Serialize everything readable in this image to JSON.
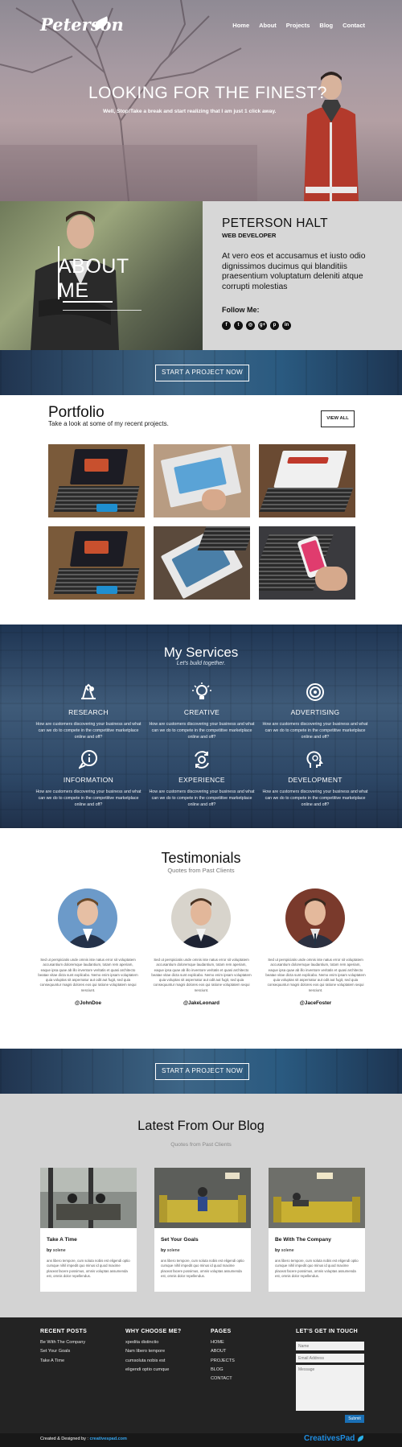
{
  "header": {
    "logo": "Peterson",
    "nav": [
      "Home",
      "About",
      "Projects",
      "Blog",
      "Contact"
    ]
  },
  "hero": {
    "title": "LOOKING FOR THE FINEST?",
    "subtitle": "Well, Stop!Take a break and start realizing that I am just 1 click away."
  },
  "about": {
    "title_line1": "ABOUT",
    "title_line2": "ME",
    "name": "PETERSON HALT",
    "role": "WEB DEVELOPER",
    "text": "At vero eos et accusamus et iusto odio dignissimos ducimus qui blanditiis praesentium voluptatum deleniti atque corrupti molestias",
    "follow_label": "Follow Me:",
    "socials": [
      "facebook-icon",
      "twitter-icon",
      "instagram-icon",
      "google-plus-icon",
      "pinterest-icon",
      "linkedin-icon"
    ],
    "social_glyphs": [
      "f",
      "t",
      "◎",
      "g+",
      "p",
      "in"
    ]
  },
  "cta": {
    "label": "START A PROJECT NOW"
  },
  "portfolio": {
    "title": "Portfolio",
    "subtitle": "Take a look at some of my recent projects.",
    "view_all": "VIEW ALL"
  },
  "services": {
    "title": "My Services",
    "subtitle": "Let's build together.",
    "items": [
      {
        "name": "RESEARCH",
        "icon": "research-icon",
        "desc": "How are customers discovering your business and what can we do to compete in the competitive marketplace online and off?"
      },
      {
        "name": "CREATIVE",
        "icon": "lightbulb-icon",
        "desc": "How are customers discovering your business and what can we do to compete in the competitive marketplace online and off?"
      },
      {
        "name": "ADVERTISING",
        "icon": "target-icon",
        "desc": "How are customers discovering your business and what can we do to compete in the competitive marketplace online and off?"
      },
      {
        "name": "INFORMATION",
        "icon": "info-bubble-icon",
        "desc": "How are customers discovering your business and what can we do to compete in the competitive marketplace online and off?"
      },
      {
        "name": "EXPERIENCE",
        "icon": "gear-cycle-icon",
        "desc": "How are customers discovering your business and what can we do to compete in the competitive marketplace online and off?"
      },
      {
        "name": "DEVELOPMENT",
        "icon": "head-gear-icon",
        "desc": "How are customers discovering your business and what can we do to compete in the competitive marketplace online and off?"
      }
    ]
  },
  "testimonials": {
    "title": "Testimonials",
    "subtitle": "Quotes from Past Clients",
    "items": [
      {
        "handle": "@JohnDoe",
        "text": "Sed ut perspiciatis unde omnis iste natus error sit voluptatem accusantium doloremque laudantium, totam rem aperiam, eaque ipsa quae ab illo inventore veritatis et quasi architecto beatae vitae dicta sunt explicabo. Nemo enim ipsam voluptatem quia voluptas sit aspernatur aut odit aut fugit, sed quia consequuntur magni dolores eos qui ratione voluptatem sequi nesciunt."
      },
      {
        "handle": "@JakeLeonard",
        "text": "Sed ut perspiciatis unde omnis iste natus error sit voluptatem accusantium doloremque laudantium, totam rem aperiam, eaque ipsa quae ab illo inventore veritatis et quasi architecto beatae vitae dicta sunt explicabo. Nemo enim ipsam voluptatem quia voluptas sit aspernatur aut odit aut fugit, sed quia consequuntur magni dolores eos qui ratione voluptatem sequi nesciunt."
      },
      {
        "handle": "@JaceFoster",
        "text": "Sed ut perspiciatis unde omnis iste natus error sit voluptatem accusantium doloremque laudantium, totam rem aperiam, eaque ipsa quae ab illo inventore veritatis et quasi architecto beatae vitae dicta sunt explicabo. Nemo enim ipsam voluptatem quia voluptas sit aspernatur aut odit aut fugit, sed quia consequuntur magni dolores eos qui ratione voluptatem sequi nesciunt."
      }
    ]
  },
  "blog": {
    "title": "Latest From Our Blog",
    "subtitle": "Quotes from Past Clients",
    "posts": [
      {
        "title": "Take A Time",
        "by": "by",
        "author": "solene",
        "text": "ans libero tempore, cum soluta nobis est eligendi optio cumque nihil impedit quo minus id quod maxime placeat facere possimus, omnis voluptas assumenda est, omnis dolor repellendus."
      },
      {
        "title": "Set Your Goals",
        "by": "by",
        "author": "solene",
        "text": "ans libero tempore, cum soluta nobis est eligendi optio cumque nihil impedit quo minus id quod maxime placeat facere possimus, omnis voluptas assumenda est, omnis dolor repellendus."
      },
      {
        "title": "Be With The Company",
        "by": "by",
        "author": "solene",
        "text": "ans libero tempore, cum soluta nobis est eligendi optio cumque nihil impedit quo minus id quod maxime placeat facere possimus, omnis voluptas assumenda est, omnis dolor repellendus."
      }
    ]
  },
  "footer": {
    "recent_posts": {
      "heading": "RECENT POSTS",
      "items": [
        "Be With The Company",
        "Set Your Goals",
        "Take A Time"
      ]
    },
    "why_choose": {
      "heading": "WHY CHOOSE ME?",
      "items": [
        "xpedita distinctio",
        "Nam libero tempore",
        "cumsoluta nobis est",
        "eligendi optio cumque"
      ]
    },
    "pages": {
      "heading": "PAGES",
      "items": [
        "HOME",
        "ABOUT",
        "PROJECTS",
        "BLOG",
        "CONTACT"
      ]
    },
    "contact": {
      "heading": "LET'S GET IN TOUCH",
      "name_placeholder": "Name",
      "email_placeholder": "Email Address",
      "message_placeholder": "Message",
      "submit": "Submit"
    },
    "credit_prefix": "Created & Designed by :",
    "credit_link": "creativespad.com",
    "brand": "CreativesPad"
  },
  "colors": {
    "accent_blue": "#1a6fb4",
    "brand_blue": "#1f8de0",
    "footer_bg": "#232323",
    "about_panel": "#d7d7d7"
  }
}
